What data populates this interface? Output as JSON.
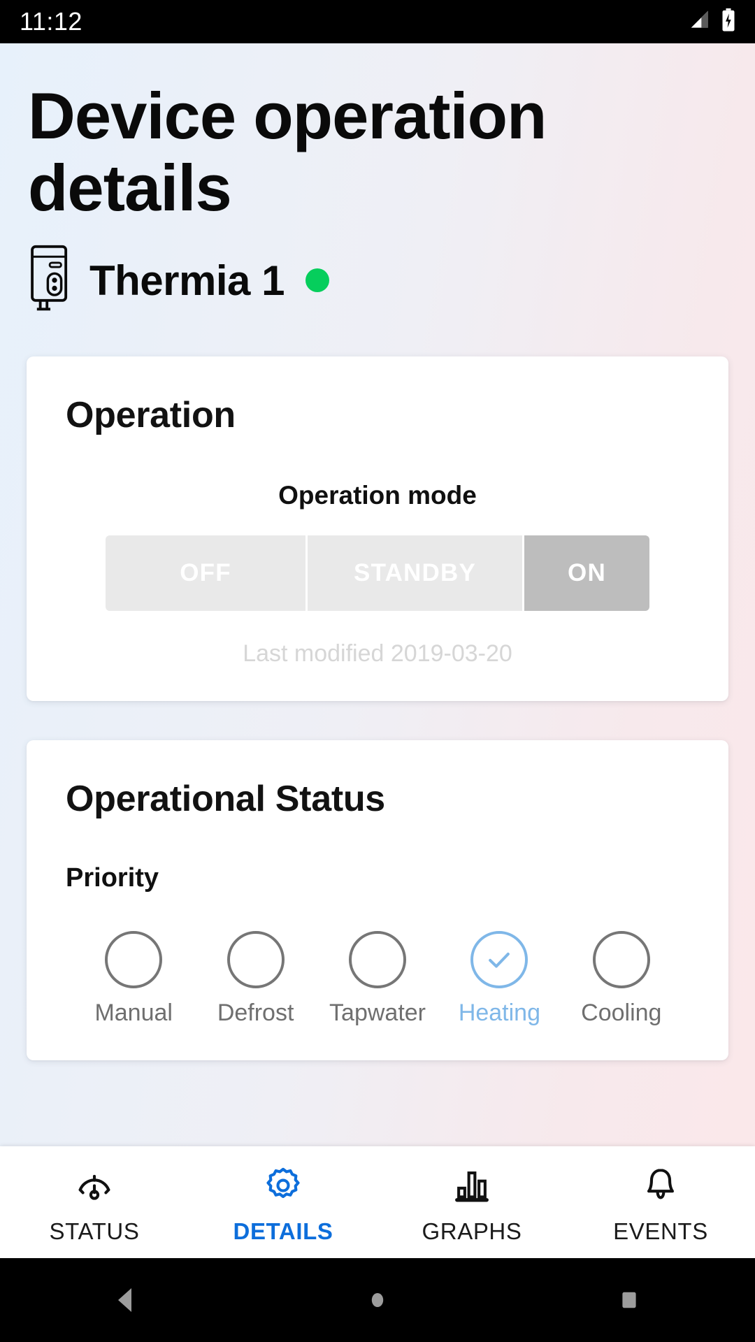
{
  "status_bar": {
    "time": "11:12",
    "signal_icon": "cellular-signal-icon",
    "battery_icon": "battery-charging-icon"
  },
  "header": {
    "title": "Device operation details",
    "device_icon": "heat-pump-icon",
    "device_name": "Thermia 1",
    "online_indicator": "online-status-dot",
    "online_color": "#06CE5C"
  },
  "operation_card": {
    "title": "Operation",
    "mode_label": "Operation mode",
    "modes": [
      {
        "label": "OFF",
        "selected": false
      },
      {
        "label": "STANDBY",
        "selected": false
      },
      {
        "label": "ON",
        "selected": true
      }
    ],
    "selected_mode": "ON",
    "last_modified": "Last modified 2019-03-20",
    "unselected_color": "#E9E9E9",
    "selected_color": "#BDBDBD"
  },
  "operational_status_card": {
    "title": "Operational Status",
    "priority_label": "Priority",
    "priorities": [
      {
        "label": "Manual",
        "selected": false
      },
      {
        "label": "Defrost",
        "selected": false
      },
      {
        "label": "Tapwater",
        "selected": false
      },
      {
        "label": "Heating",
        "selected": true
      },
      {
        "label": "Cooling",
        "selected": false
      }
    ],
    "selected_priority": "Heating",
    "accent_color": "#7FB7E8",
    "inactive_color": "#767676"
  },
  "tab_bar": {
    "active_color": "#0D6EDB",
    "tabs": [
      {
        "label": "STATUS",
        "icon": "gauge-icon",
        "active": false
      },
      {
        "label": "DETAILS",
        "icon": "gear-icon",
        "active": true
      },
      {
        "label": "GRAPHS",
        "icon": "bar-chart-icon",
        "active": false
      },
      {
        "label": "EVENTS",
        "icon": "bell-icon",
        "active": false
      }
    ]
  },
  "android_nav": {
    "back_icon": "back-triangle-icon",
    "home_icon": "home-circle-icon",
    "recents_icon": "recents-square-icon"
  }
}
